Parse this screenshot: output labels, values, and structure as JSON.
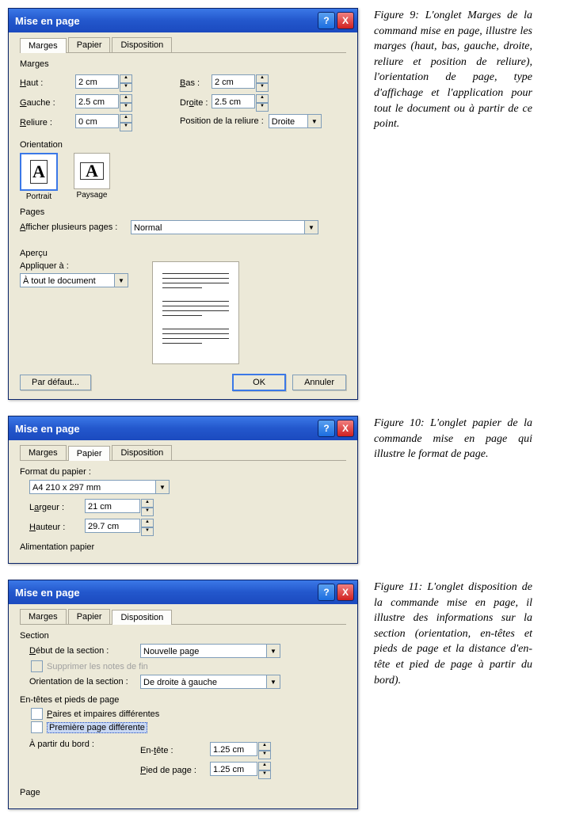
{
  "dialog_title": "Mise en page",
  "titlebar_help": "?",
  "titlebar_close": "X",
  "tabs": {
    "marges": "Marges",
    "papier": "Papier",
    "disposition": "Disposition"
  },
  "fig9": {
    "group_marges": "Marges",
    "haut_lbl": "Haut :",
    "haut_u": "H",
    "haut_val": "2 cm",
    "bas_lbl": "Bas :",
    "bas_u": "B",
    "bas_val": "2 cm",
    "gauche_lbl": "Gauche :",
    "gauche_u": "G",
    "gauche_val": "2.5 cm",
    "droite_lbl": "Droite :",
    "droite_u": "D",
    "droite_val": "2.5 cm",
    "reliure_lbl": "Reliure :",
    "reliure_u": "R",
    "reliure_val": "0 cm",
    "pos_reliure_lbl": "Position de la reliure :",
    "pos_reliure_val": "Droite",
    "group_orientation": "Orientation",
    "portrait": "Portrait",
    "paysage": "Paysage",
    "group_pages": "Pages",
    "afficher_lbl": "Afficher plusieurs pages :",
    "afficher_u": "A",
    "afficher_val": "Normal",
    "group_apercu": "Aperçu",
    "appliquer_lbl": "Appliquer à :",
    "appliquer_val": "À tout le document",
    "par_defaut": "Par défaut...",
    "ok": "OK",
    "annuler": "Annuler"
  },
  "fig10": {
    "group_format": "Format du papier :",
    "format_val": "A4 210 x 297 mm",
    "largeur_lbl": "Largeur :",
    "largeur_u": "a",
    "largeur_val": "21 cm",
    "hauteur_lbl": "Hauteur :",
    "hauteur_u": "H",
    "hauteur_val": "29.7 cm",
    "group_alim": "Alimentation papier"
  },
  "fig11": {
    "group_section": "Section",
    "debut_lbl": "Début de la section :",
    "debut_u": "D",
    "debut_val": "Nouvelle page",
    "supprimer_notes": "Supprimer les notes de fin",
    "orient_lbl": "Orientation de la section :",
    "orient_val": "De droite à gauche",
    "group_entetes": "En-têtes et pieds de page",
    "paires_lbl": "Paires et impaires différentes",
    "paires_u": "P",
    "premiere_lbl": "Première page différente",
    "apartir_lbl": "À partir du bord :",
    "entete_lbl": "En-tête :",
    "entete_u": "t",
    "entete_val": "1.25 cm",
    "pied_lbl": "Pied de page :",
    "pied_u": "P",
    "pied_val": "1.25 cm",
    "group_page": "Page"
  },
  "captions": {
    "c9": "Figure 9: L'onglet Marges de la command mise en page, illustre les marges (haut, bas, gauche, droite, reliure et position de reliure), l'orientation de page, type d'affichage et l'application pour tout le document ou à partir de ce point.",
    "c10": "Figure 10: L'onglet papier de la commande mise en page qui illustre le format de page.",
    "c11": "Figure 11: L'onglet disposition de la commande mise en page, il illustre des informations sur la section (orientation, en-têtes et pieds de page et la distance d'en-tête et pied de page à partir du bord)."
  }
}
